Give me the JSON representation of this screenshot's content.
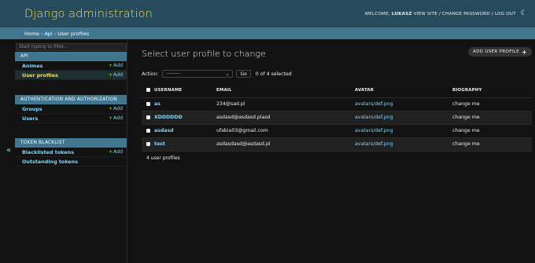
{
  "header": {
    "brand": "Django administration",
    "welcome": "WELCOME,",
    "username": "LUKASZ",
    "links": [
      "VIEW SITE",
      "CHANGE PASSWORD",
      "LOG OUT"
    ],
    "separator": "/",
    "theme_icon": "moon-icon",
    "theme_glyph": "☾"
  },
  "breadcrumbs": {
    "items": [
      "Home",
      "Api",
      "User profiles"
    ],
    "separator": "›"
  },
  "sidebar": {
    "filter_placeholder": "Start typing to filter...",
    "toggle_glyph": "«",
    "apps": [
      {
        "caption": "API",
        "models": [
          {
            "name": "Animes",
            "add": "Add"
          },
          {
            "name": "User profiles",
            "add": "Add"
          }
        ]
      },
      {
        "caption": "AUTHENTICATION AND AUTHORIZATION",
        "models": [
          {
            "name": "Groups",
            "add": "Add"
          },
          {
            "name": "Users",
            "add": "Add"
          }
        ]
      },
      {
        "caption": "TOKEN BLACKLIST",
        "models": [
          {
            "name": "Blacklisted tokens",
            "add": "Add"
          },
          {
            "name": "Outstanding tokens",
            "add": ""
          }
        ]
      }
    ]
  },
  "content": {
    "title": "Select user profile to change",
    "add_button": "ADD USER PROFILE",
    "action_label": "Action:",
    "action_value": "---------",
    "go_label": "Go",
    "selected_count": "0 of 4 selected",
    "columns": [
      "USERNAME",
      "EMAIL",
      "AVATAR",
      "BIOGRAPHY"
    ],
    "rows": [
      {
        "username": "as",
        "email": "234@sad.pl",
        "avatar": "avatars/def.png",
        "biography": "change me"
      },
      {
        "username": "XDDDDDD",
        "email": "asdasd@asdasd.plasd",
        "avatar": "avatars/def.png",
        "biography": "change me"
      },
      {
        "username": "asdasd",
        "email": "ufabia03@gmail.com",
        "avatar": "avatars/def.png",
        "biography": "change me"
      },
      {
        "username": "test",
        "email": "asdasdasd@asdasd.pl",
        "avatar": "avatars/def.png",
        "biography": "change me"
      }
    ],
    "paginator": "4 user profiles"
  },
  "colors": {
    "header_bg": "#264b5d",
    "breadcrumbs_bg": "#417690",
    "brand": "#f5dd5d",
    "link": "#81d4fa",
    "add_plus": "#70bf2b",
    "body_bg": "#121212"
  }
}
